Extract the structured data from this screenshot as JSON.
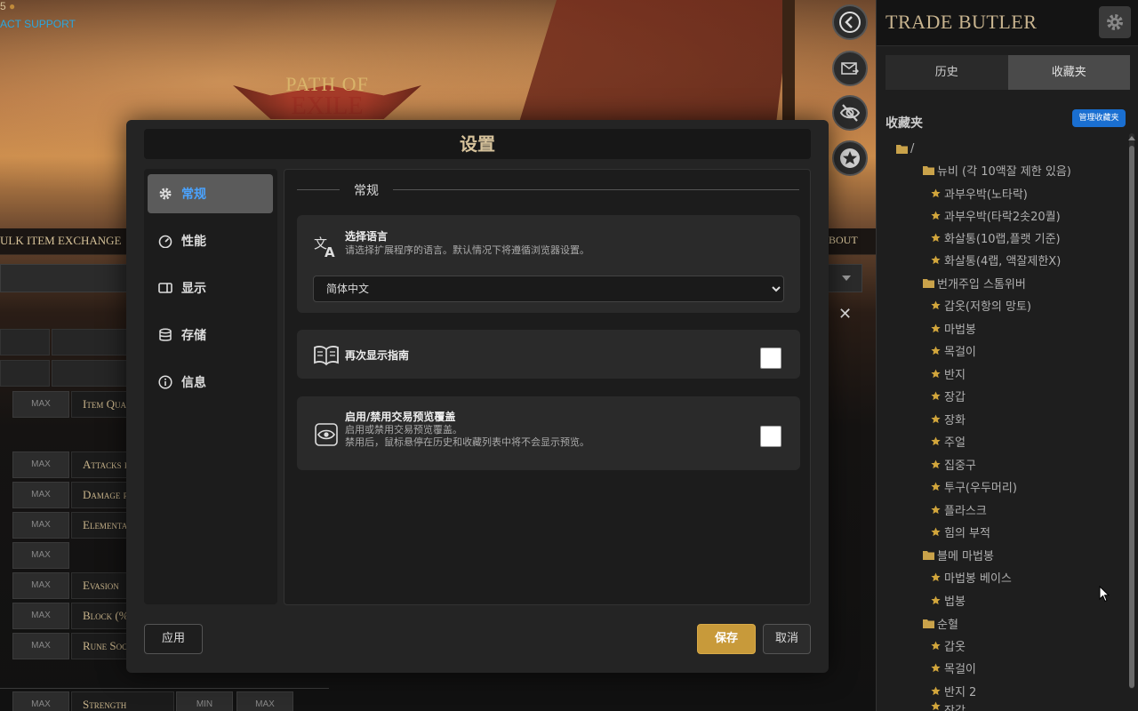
{
  "background": {
    "counter": "5",
    "support_link": "ACT SUPPORT",
    "logo_line1": "PATH OF",
    "logo_line2": "EXILE",
    "nav_left": "ULK ITEM EXCHANGE",
    "nav_right": "BOUT",
    "rows": [
      {
        "max": "MAX",
        "label": "Item Qua"
      },
      {
        "max": "MAX",
        "label": "Attacks pe"
      },
      {
        "max": "MAX",
        "label": "Damage pe"
      },
      {
        "max": "MAX",
        "label": "Elemental"
      },
      {
        "max": "MAX",
        "label": ""
      },
      {
        "max": "MAX",
        "label": "Evasion"
      },
      {
        "max": "MAX",
        "label": "Block (%"
      },
      {
        "max": "MAX",
        "label": "Rune Sock"
      },
      {
        "max": "MAX",
        "label": "Strength"
      }
    ],
    "min_label": "MIN",
    "max_label": "MAX"
  },
  "panel": {
    "title": "TRADE BUTLER",
    "tabs": [
      {
        "label": "历史"
      },
      {
        "label": "收藏夹"
      }
    ],
    "active_tab": "收藏夹",
    "favorites_heading": "收藏夹",
    "manage_button": "管理收藏夹",
    "tree": [
      {
        "label": "/",
        "type": "folder"
      },
      {
        "label": "뉴비 (각 10액잘 제한 있음)",
        "type": "folder"
      },
      {
        "label": "과부우박(노타락)",
        "type": "item"
      },
      {
        "label": "과부우박(타락2솟20퀄)",
        "type": "item"
      },
      {
        "label": "화살통(10랩,플랫 기준)",
        "type": "item"
      },
      {
        "label": "화살통(4랩, 액잘제한X)",
        "type": "item"
      },
      {
        "label": "번개주입 스톰위버",
        "type": "folder"
      },
      {
        "label": "갑옷(저항의 망토)",
        "type": "item"
      },
      {
        "label": "마법봉",
        "type": "item"
      },
      {
        "label": "목걸이",
        "type": "item"
      },
      {
        "label": "반지",
        "type": "item"
      },
      {
        "label": "장갑",
        "type": "item"
      },
      {
        "label": "장화",
        "type": "item"
      },
      {
        "label": "주얼",
        "type": "item"
      },
      {
        "label": "집중구",
        "type": "item"
      },
      {
        "label": "투구(우두머리)",
        "type": "item"
      },
      {
        "label": "플라스크",
        "type": "item"
      },
      {
        "label": "힘의 부적",
        "type": "item"
      },
      {
        "label": "블메 마법봉",
        "type": "folder"
      },
      {
        "label": "마법봉 베이스",
        "type": "item"
      },
      {
        "label": "법봉",
        "type": "item"
      },
      {
        "label": "순혈",
        "type": "folder"
      },
      {
        "label": "갑옷",
        "type": "item"
      },
      {
        "label": "목걸이",
        "type": "item"
      },
      {
        "label": "반지 2",
        "type": "item"
      },
      {
        "label": "장갑",
        "type": "item"
      }
    ]
  },
  "modal": {
    "title": "设置",
    "menu": [
      {
        "label": "常规",
        "icon": "gear-icon"
      },
      {
        "label": "性能",
        "icon": "gauge-icon"
      },
      {
        "label": "显示",
        "icon": "display-icon"
      },
      {
        "label": "存储",
        "icon": "database-icon"
      },
      {
        "label": "信息",
        "icon": "info-icon"
      }
    ],
    "active_menu": "常规",
    "section_title": "常规",
    "language": {
      "title": "选择语言",
      "desc": "请选择扩展程序的语言。默认情况下将遵循浏览器设置。",
      "selected": "简体中文"
    },
    "guide": {
      "title": "再次显示指南",
      "checked": false
    },
    "preview": {
      "title": "启用/禁用交易预览覆盖",
      "desc1": "启用或禁用交易预览覆盖。",
      "desc2": "禁用后，鼠标悬停在历史和收藏列表中将不会显示预览。",
      "checked": false
    },
    "apply_label": "应用",
    "save_label": "保存",
    "cancel_label": "取消"
  },
  "colors": {
    "accent_blue": "#4aa3ff",
    "save_gold": "#c89a3a",
    "folder_gold": "#c9a24a",
    "star_gold": "#d2a63c"
  }
}
